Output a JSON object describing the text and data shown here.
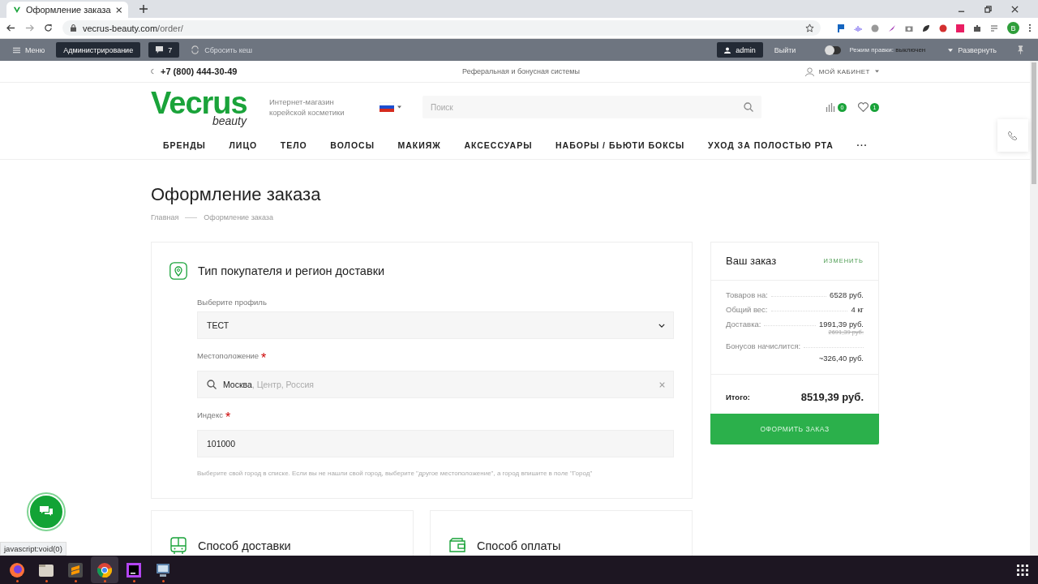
{
  "browser": {
    "tab_title": "Оформление заказа",
    "url_host": "vecrus-beauty.com",
    "url_path": "/order/",
    "profile_initial": "B"
  },
  "admin_bar": {
    "menu": "Меню",
    "admin": "Администрирование",
    "comments": "7",
    "reset": "Сбросить кеш",
    "user": "admin",
    "logout": "Выйти",
    "edit_label": "Режим правки:",
    "edit_state": "выключен",
    "edit_on": false,
    "expand": "Развернуть"
  },
  "header": {
    "phone": "+7 (800) 444-30-49",
    "referral": "Реферальная и бонусная системы",
    "cabinet": "МОЙ КАБИНЕТ",
    "logo_word": "Vecrus",
    "logo_sub": "beauty",
    "tagline": "Интернет-магазин корейской косметики",
    "search_placeholder": "Поиск",
    "compare_count": "0",
    "favorites_count": "1"
  },
  "nav": [
    "БРЕНДЫ",
    "ЛИЦО",
    "ТЕЛО",
    "ВОЛОСЫ",
    "МАКИЯЖ",
    "АКСЕССУАРЫ",
    "НАБОРЫ / БЬЮТИ БОКСЫ",
    "УХОД ЗА ПОЛОСТЬЮ РТА",
    "···"
  ],
  "page": {
    "title": "Оформление заказа",
    "breadcrumbs": [
      "Главная",
      "Оформление заказа"
    ]
  },
  "buyer_section": {
    "title": "Тип покупателя и регион доставки",
    "fields": [
      {
        "kind": "select",
        "label": "Выберите профиль",
        "value": "ТЕСТ"
      },
      {
        "kind": "location",
        "label": "Местоположение",
        "required_mark": "*",
        "value": "Москва",
        "detail": ", Центр, Россия"
      },
      {
        "kind": "text",
        "label": "Индекс",
        "required_mark": "*",
        "value": "101000"
      }
    ],
    "hint": "Выберите свой город в списке. Если вы не нашли свой город, выберите \"другое местоположение\", а город впишите в поле \"Город\""
  },
  "summary": {
    "title": "Ваш заказ",
    "edit_link": "ИЗМЕНИТЬ",
    "rows": [
      {
        "kind": "inline",
        "label": "Товаров на:",
        "value": "6528 руб."
      },
      {
        "kind": "inline",
        "label": "Общий вес:",
        "value": "4 кг"
      },
      {
        "kind": "inline",
        "label": "Доставка:",
        "value": "1991,39 руб.",
        "old_value": "2691,39 руб."
      },
      {
        "kind": "stacked",
        "label": "Бонусов начислится:",
        "value": "~326,40 руб."
      }
    ],
    "total_label": "Итого:",
    "total_value": "8519,39 руб.",
    "submit": "ОФОРМИТЬ ЗАКАЗ"
  },
  "cards": [
    {
      "kind": "delivery",
      "title": "Способ доставки"
    },
    {
      "kind": "payment",
      "title": "Способ оплаты"
    }
  ],
  "status_text": "javascript:void(0)",
  "taskbar": {
    "apps": [
      {
        "kind": "firefox",
        "selected": false
      },
      {
        "kind": "files",
        "selected": false
      },
      {
        "kind": "sublime",
        "selected": false
      },
      {
        "kind": "chrome",
        "selected": true
      },
      {
        "kind": "phpstorm",
        "selected": false
      },
      {
        "kind": "monitor",
        "selected": false
      }
    ]
  }
}
